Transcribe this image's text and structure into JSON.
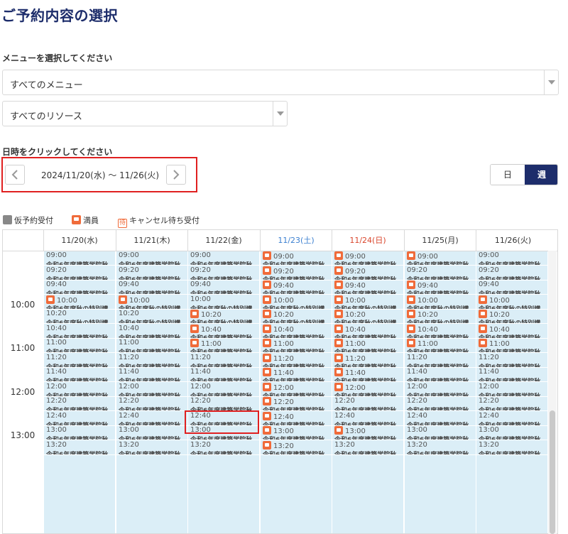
{
  "page": {
    "title": "ご予約内容の選択"
  },
  "menu_section": {
    "label": "メニューを選択してください",
    "menu_select": "すべてのメニュー",
    "resource_select": "すべてのリソース"
  },
  "date_section": {
    "label": "日時をクリックしてください",
    "range": "2024/11/20(水) 〜 11/26(火)"
  },
  "view_toggle": {
    "day": "日",
    "week": "週"
  },
  "legend": {
    "provisional": "仮予約受付",
    "full": "満員",
    "wait_mark": "待",
    "waitlist": "キャンセル待ち受付"
  },
  "calendar": {
    "days": [
      {
        "label": "11/20(水)",
        "type": "weekday"
      },
      {
        "label": "11/21(木)",
        "type": "weekday"
      },
      {
        "label": "11/22(金)",
        "type": "weekday"
      },
      {
        "label": "11/23(土)",
        "type": "saturday"
      },
      {
        "label": "11/24(日)",
        "type": "holiday"
      },
      {
        "label": "11/25(月)",
        "type": "weekday"
      },
      {
        "label": "11/26(火)",
        "type": "weekday"
      }
    ],
    "hour_labels": [
      "10:00",
      "11:00",
      "12:00",
      "13:00"
    ],
    "slot_times": [
      "09:00",
      "09:20",
      "09:40",
      "10:00",
      "10:20",
      "10:40",
      "11:00",
      "11:20",
      "11:40",
      "12:00",
      "12:20",
      "12:40",
      "13:00",
      "13:20"
    ],
    "slot_caption_a": "令和6年度建築学院秋",
    "slot_caption_b": "令和6年度秋の特別講",
    "full_slots": [
      [
        3
      ],
      [
        3
      ],
      [
        4,
        5,
        6
      ],
      [
        0,
        1,
        2,
        3,
        4,
        5,
        6,
        7,
        8,
        9,
        10,
        11,
        12,
        13
      ],
      [
        0,
        1,
        2,
        3,
        4,
        5,
        6,
        7,
        8,
        9,
        12
      ],
      [
        0,
        2,
        3,
        4,
        5,
        6
      ],
      [
        3,
        4,
        5,
        6
      ]
    ],
    "selected": {
      "day": 2,
      "slot": 8
    }
  },
  "colors": {
    "title": "#1d2d6b",
    "slot_bg": "#dbeef7",
    "full_icon": "#f06b3a",
    "highlight": "#e02020",
    "saturday": "#3a7fd0",
    "sunday": "#d9452b"
  }
}
